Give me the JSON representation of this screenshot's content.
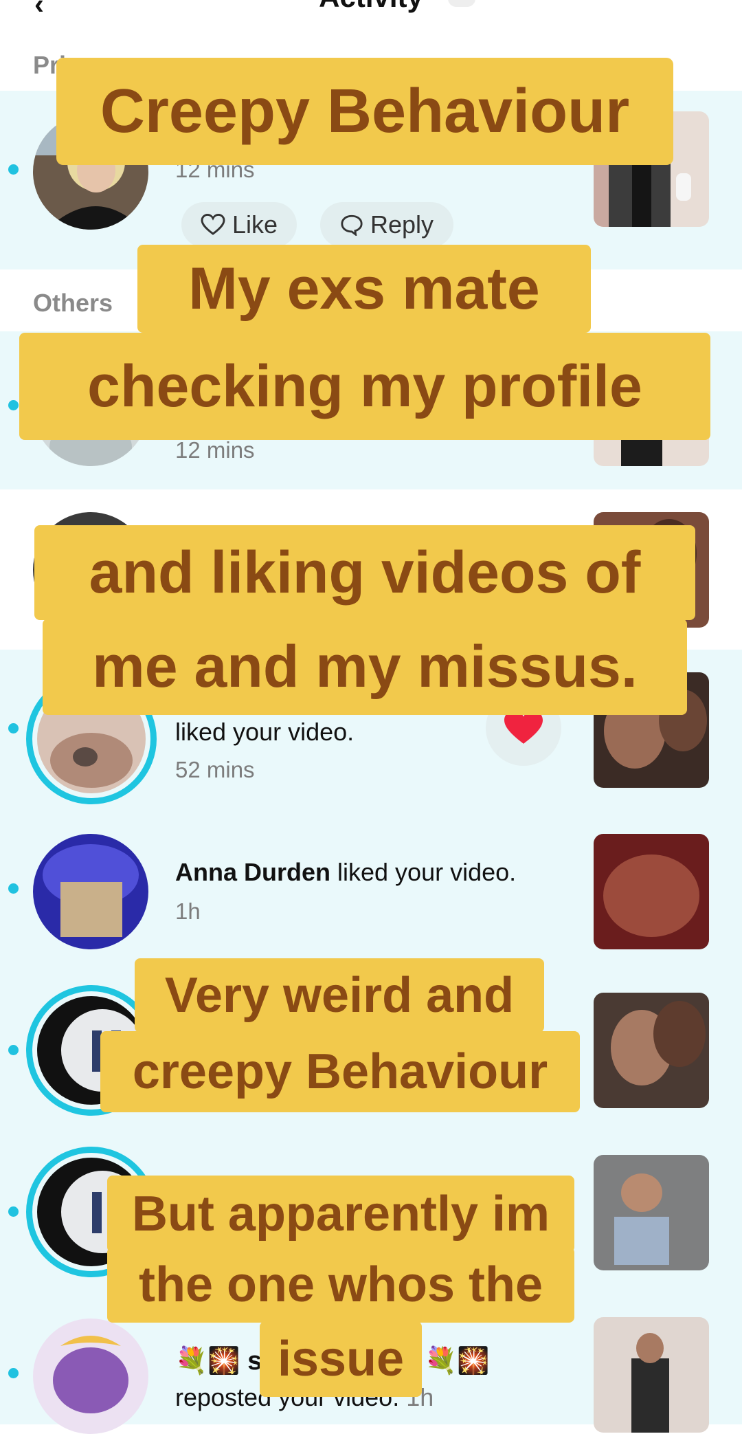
{
  "header": {
    "title": "Activity",
    "back_icon": "chevron-left-icon"
  },
  "sections": {
    "private_label": "Pri",
    "others_label": "Others"
  },
  "rows": [
    {
      "time": "12 mins",
      "like_label": "Like",
      "reply_label": "Reply"
    },
    {
      "time": "12 mins"
    },
    {
      "text_suffix": "liked your video.",
      "time": "52 mins"
    },
    {
      "name": "Anna Durden",
      "text_suffix": " liked your video.",
      "time": "1h"
    },
    {
      "emoji_left": "💐🎇",
      "name_fragment": "s",
      "emoji_right": "💐🎇",
      "text_suffix": "reposted your video.",
      "time": "1h"
    }
  ],
  "captions": {
    "c1": "Creepy Behaviour",
    "c2a": "My exs mate",
    "c2b": "checking my profile",
    "c3a": "and liking videos of",
    "c3b": "me and my missus.",
    "c4a": "Very weird and",
    "c4b": "creepy Behaviour",
    "c5a": "But apparently im",
    "c5b": "the one whos the",
    "c5c": "issue"
  },
  "colors": {
    "caption_bg": "#f2c94c",
    "caption_text": "#8a4a14",
    "unread_dot": "#20c2e0",
    "band": "#eaf9fb",
    "heart": "#f0233f"
  }
}
